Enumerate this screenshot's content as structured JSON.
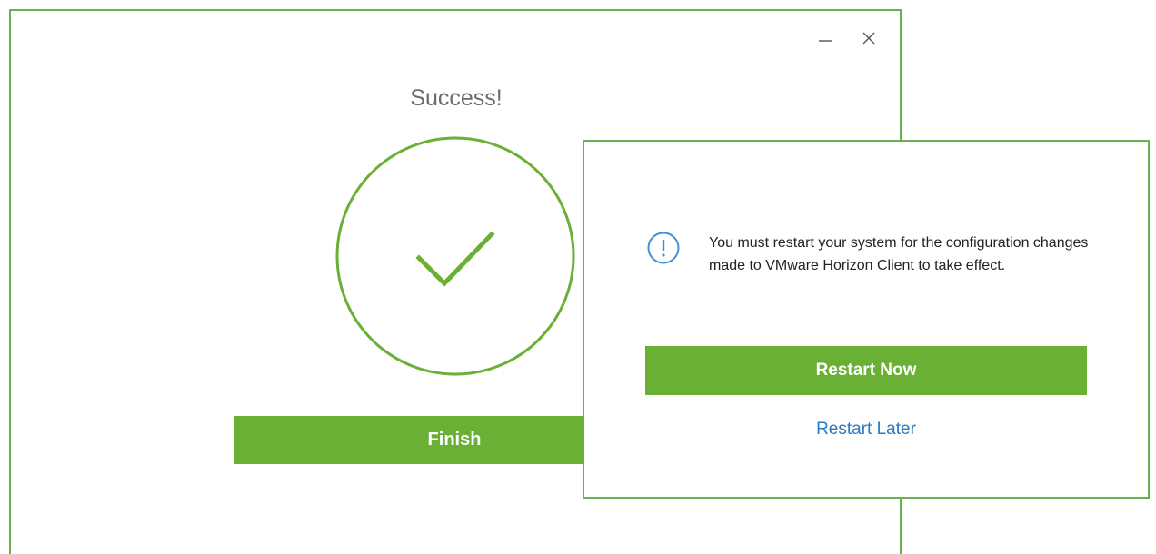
{
  "main_window": {
    "title": "Success!",
    "finish_label": "Finish",
    "controls": {
      "minimize_icon": "minimize-icon",
      "close_icon": "close-icon"
    },
    "status_icon": "check-circle-icon"
  },
  "restart_dialog": {
    "message": "You must restart your system for the configuration changes made to VMware Horizon Client to take effect.",
    "restart_now_label": "Restart Now",
    "restart_later_label": "Restart Later",
    "icon": "info-icon"
  },
  "colors": {
    "accent_green": "#6ab035",
    "border_green": "#6ab04c",
    "link_blue": "#2b78c2",
    "info_blue": "#3c8fde"
  }
}
